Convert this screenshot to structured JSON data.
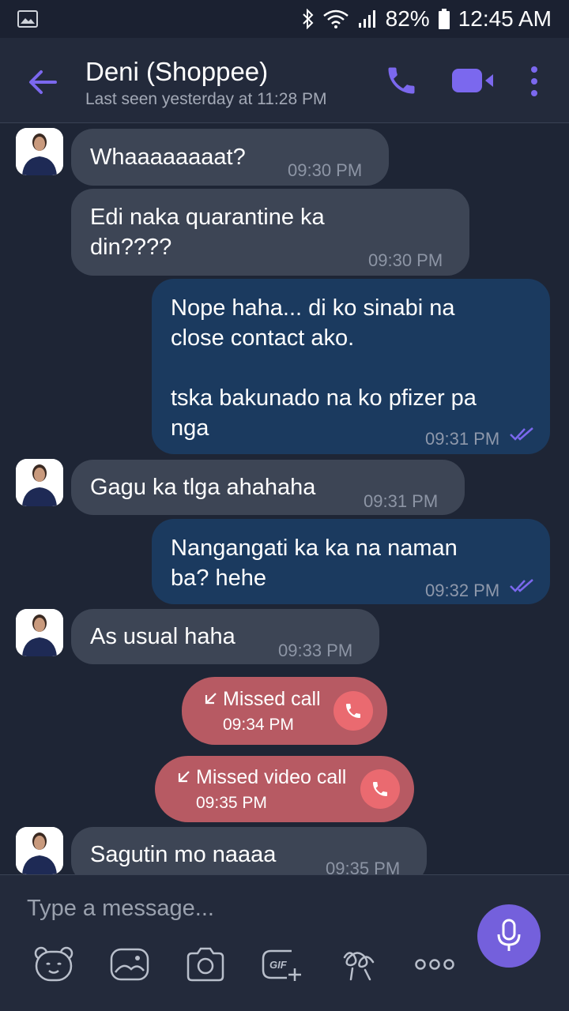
{
  "status_bar": {
    "battery": "82%",
    "time": "12:45 AM"
  },
  "header": {
    "contact_name": "Deni (Shoppee)",
    "last_seen": "Last seen yesterday  at 11:28 PM"
  },
  "messages": [
    {
      "dir": "in",
      "text": "Whaaaaaaaat?",
      "time": "09:30 PM"
    },
    {
      "dir": "in",
      "text": "Edi naka quarantine ka\ndin????",
      "time": "09:30 PM"
    },
    {
      "dir": "out",
      "text": "Nope haha... di ko sinabi na\nclose contact ako.\n\ntska bakunado na ko pfizer pa\nnga",
      "time": "09:31 PM"
    },
    {
      "dir": "in",
      "text": "Gagu ka tlga ahahaha",
      "time": "09:31 PM"
    },
    {
      "dir": "out",
      "text": "Nangangati ka ka na naman\nba? hehe",
      "time": "09:32 PM"
    },
    {
      "dir": "in",
      "text": "As usual haha",
      "time": "09:33 PM"
    },
    {
      "dir": "missed",
      "text": "Missed call",
      "time": "09:34 PM"
    },
    {
      "dir": "missed",
      "text": "Missed video call",
      "time": "09:35 PM"
    },
    {
      "dir": "in",
      "text": "Sagutin mo naaaa",
      "time": "09:35 PM"
    }
  ],
  "composer": {
    "placeholder": "Type a message..."
  },
  "colors": {
    "background": "#1e2535",
    "incoming_bubble": "#3d4555",
    "outgoing_bubble": "#1b3a5f",
    "accent": "#7460dc",
    "missed_call": "#b75a63"
  }
}
